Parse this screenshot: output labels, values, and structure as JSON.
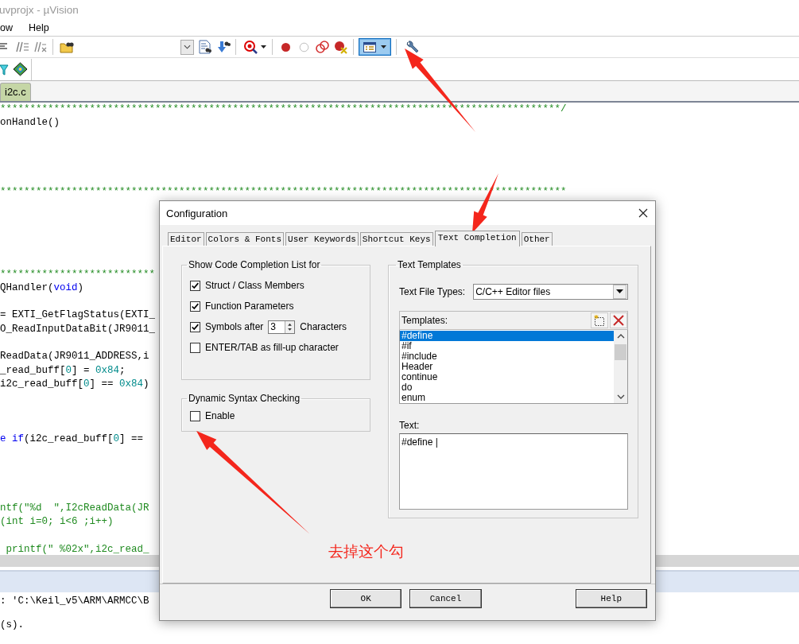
{
  "window": {
    "title": "uvprojx - µVision"
  },
  "menu": [
    "ow",
    "Help"
  ],
  "toolbar": {
    "view_button": {
      "selected": true
    }
  },
  "editor_tabs": [
    {
      "label": "i2c.c",
      "selected": true
    }
  ],
  "code_lines": [
    {
      "kind": "code",
      "segments": [
        {
          "kind": "comment",
          "text": "**********************************************************************************************/"
        }
      ]
    },
    {
      "kind": "code",
      "segments": [
        {
          "kind": "plain",
          "text": "onHandle()"
        }
      ]
    },
    {
      "kind": "blank"
    },
    {
      "kind": "blank"
    },
    {
      "kind": "blank"
    },
    {
      "kind": "blank"
    },
    {
      "kind": "code",
      "segments": [
        {
          "kind": "comment",
          "text": "***********************************************************************************************"
        }
      ]
    },
    {
      "kind": "blank"
    },
    {
      "kind": "blank"
    },
    {
      "kind": "blank"
    },
    {
      "kind": "blank"
    },
    {
      "kind": "blank"
    },
    {
      "kind": "code",
      "segments": [
        {
          "kind": "comment",
          "text": "**************************"
        }
      ]
    },
    {
      "kind": "code",
      "segments": [
        {
          "kind": "plain",
          "text": "QHandler("
        },
        {
          "kind": "keyword",
          "text": "void"
        },
        {
          "kind": "plain",
          "text": ")"
        }
      ]
    },
    {
      "kind": "blank"
    },
    {
      "kind": "code",
      "segments": [
        {
          "kind": "plain",
          "text": "= EXTI_GetFlagStatus(EXTI_"
        }
      ]
    },
    {
      "kind": "code",
      "segments": [
        {
          "kind": "plain",
          "text": "O_ReadInputDataBit(JR9011_"
        }
      ]
    },
    {
      "kind": "blank"
    },
    {
      "kind": "code",
      "segments": [
        {
          "kind": "plain",
          "text": "ReadData(JR9011_ADDRESS,i"
        }
      ]
    },
    {
      "kind": "code",
      "segments": [
        {
          "kind": "plain",
          "text": "_read_buff["
        },
        {
          "kind": "number",
          "text": "0"
        },
        {
          "kind": "plain",
          "text": "] = "
        },
        {
          "kind": "number",
          "text": "0x84"
        },
        {
          "kind": "plain",
          "text": ";"
        }
      ]
    },
    {
      "kind": "code",
      "segments": [
        {
          "kind": "plain",
          "text": "i2c_read_buff["
        },
        {
          "kind": "number",
          "text": "0"
        },
        {
          "kind": "plain",
          "text": "] == "
        },
        {
          "kind": "number",
          "text": "0x84"
        },
        {
          "kind": "plain",
          "text": ")"
        }
      ]
    },
    {
      "kind": "blank"
    },
    {
      "kind": "blank"
    },
    {
      "kind": "blank"
    },
    {
      "kind": "code",
      "segments": [
        {
          "kind": "keyword",
          "text": "e if"
        },
        {
          "kind": "plain",
          "text": "(i2c_read_buff["
        },
        {
          "kind": "number",
          "text": "0"
        },
        {
          "kind": "plain",
          "text": "] =="
        }
      ]
    },
    {
      "kind": "blank"
    },
    {
      "kind": "blank"
    },
    {
      "kind": "blank"
    },
    {
      "kind": "blank"
    },
    {
      "kind": "code",
      "segments": [
        {
          "kind": "comment",
          "text": "ntf(\"%d  \",I2cReadData(JR"
        }
      ]
    },
    {
      "kind": "code",
      "segments": [
        {
          "kind": "comment",
          "text": "(int i=0; i<6 ;i++)"
        }
      ]
    },
    {
      "kind": "blank"
    },
    {
      "kind": "code",
      "segments": [
        {
          "kind": "comment",
          "text": " printf(\" %02x\",i2c_read_"
        }
      ]
    }
  ],
  "build_output": [
    {
      "kind": "text",
      "text": ": 'C:\\Keil_v5\\ARM\\ARMCC\\B"
    },
    {
      "kind": "blank"
    },
    {
      "kind": "text",
      "text": "(s)."
    }
  ],
  "dialog": {
    "title": "Configuration",
    "tabs": [
      {
        "label": "Editor",
        "selected": false
      },
      {
        "label": "Colors & Fonts",
        "selected": false
      },
      {
        "label": "User Keywords",
        "selected": false
      },
      {
        "label": "Shortcut Keys",
        "selected": false
      },
      {
        "label": "Text Completion",
        "selected": true
      },
      {
        "label": "Other",
        "selected": false
      }
    ],
    "code_completion": {
      "title": "Show Code Completion List for",
      "options": [
        {
          "kind": "check",
          "label": "Struct / Class Members",
          "checked": true
        },
        {
          "kind": "check",
          "label": "Function Parameters",
          "checked": true
        },
        {
          "kind": "spin",
          "label": "Symbols after",
          "value": "3",
          "suffix": "Characters",
          "checked": true
        },
        {
          "kind": "check",
          "label": "ENTER/TAB as fill-up character",
          "checked": false
        }
      ]
    },
    "syntax_checking": {
      "title": "Dynamic Syntax Checking",
      "options": [
        {
          "kind": "check",
          "label": "Enable",
          "checked": false
        }
      ]
    },
    "text_templates": {
      "title": "Text Templates",
      "file_types_label": "Text File Types:",
      "file_types_value": "C/C++ Editor files",
      "templates_label": "Templates:",
      "templates": [
        {
          "label": "#define",
          "selected": true
        },
        {
          "label": "#if",
          "selected": false
        },
        {
          "label": "#include",
          "selected": false
        },
        {
          "label": "Header",
          "selected": false
        },
        {
          "label": "continue",
          "selected": false
        },
        {
          "label": "do",
          "selected": false
        },
        {
          "label": "enum",
          "selected": false
        }
      ],
      "text_label": "Text:",
      "text_value": "#define |"
    },
    "buttons": [
      "OK",
      "Cancel",
      "Help"
    ]
  },
  "annotation": {
    "note": "去掉这个勾"
  }
}
